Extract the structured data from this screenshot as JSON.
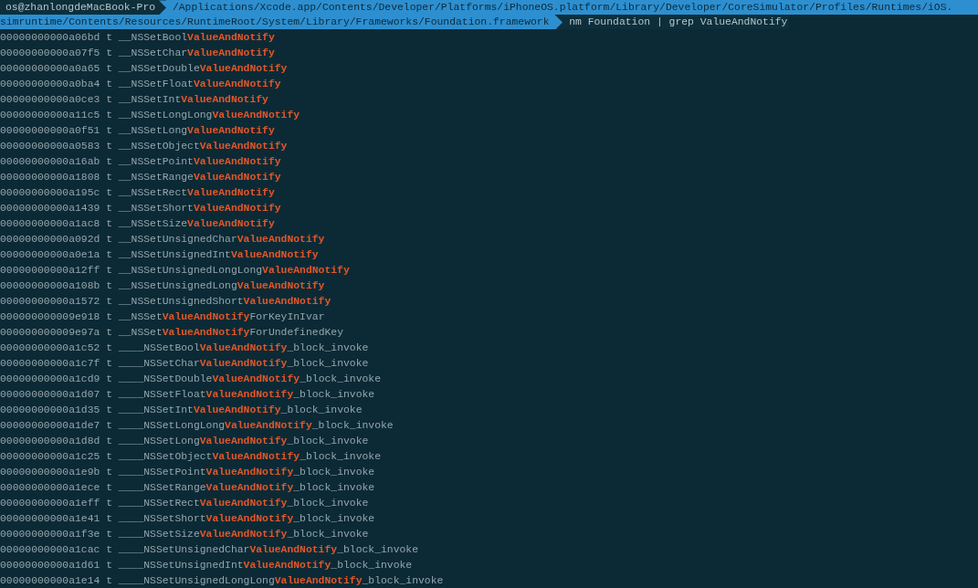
{
  "prompt": {
    "user_host": "os@zhanlongdeMacBook-Pro",
    "path_lines": [
      "/Applications/Xcode.app/Contents/Developer/Platforms/iPhoneOS.platform/Library/Developer/CoreSimulator/Profiles/Runtimes/iOS.",
      "simruntime/Contents/Resources/RuntimeRoot/System/Library/Frameworks/Foundation.framework"
    ],
    "command": "nm Foundation | grep ValueAndNotify"
  },
  "output_lines": [
    "00000000000a06bd t __NSSetBool**ValueAndNotify**",
    "00000000000a07f5 t __NSSetChar**ValueAndNotify**",
    "00000000000a0a65 t __NSSetDouble**ValueAndNotify**",
    "00000000000a0ba4 t __NSSetFloat**ValueAndNotify**",
    "00000000000a0ce3 t __NSSetInt**ValueAndNotify**",
    "00000000000a11c5 t __NSSetLongLong**ValueAndNotify**",
    "00000000000a0f51 t __NSSetLong**ValueAndNotify**",
    "00000000000a0583 t __NSSetObject**ValueAndNotify**",
    "00000000000a16ab t __NSSetPoint**ValueAndNotify**",
    "00000000000a1808 t __NSSetRange**ValueAndNotify**",
    "00000000000a195c t __NSSetRect**ValueAndNotify**",
    "00000000000a1439 t __NSSetShort**ValueAndNotify**",
    "00000000000a1ac8 t __NSSetSize**ValueAndNotify**",
    "00000000000a092d t __NSSetUnsignedChar**ValueAndNotify**",
    "00000000000a0e1a t __NSSetUnsignedInt**ValueAndNotify**",
    "00000000000a12ff t __NSSetUnsignedLongLong**ValueAndNotify**",
    "00000000000a108b t __NSSetUnsignedLong**ValueAndNotify**",
    "00000000000a1572 t __NSSetUnsignedShort**ValueAndNotify**",
    "000000000009e918 t __NSSet**ValueAndNotify**ForKeyInIvar",
    "000000000009e97a t __NSSet**ValueAndNotify**ForUndefinedKey",
    "00000000000a1c52 t ____NSSetBool**ValueAndNotify**_block_invoke",
    "00000000000a1c7f t ____NSSetChar**ValueAndNotify**_block_invoke",
    "00000000000a1cd9 t ____NSSetDouble**ValueAndNotify**_block_invoke",
    "00000000000a1d07 t ____NSSetFloat**ValueAndNotify**_block_invoke",
    "00000000000a1d35 t ____NSSetInt**ValueAndNotify**_block_invoke",
    "00000000000a1de7 t ____NSSetLongLong**ValueAndNotify**_block_invoke",
    "00000000000a1d8d t ____NSSetLong**ValueAndNotify**_block_invoke",
    "00000000000a1c25 t ____NSSetObject**ValueAndNotify**_block_invoke",
    "00000000000a1e9b t ____NSSetPoint**ValueAndNotify**_block_invoke",
    "00000000000a1ece t ____NSSetRange**ValueAndNotify**_block_invoke",
    "00000000000a1eff t ____NSSetRect**ValueAndNotify**_block_invoke",
    "00000000000a1e41 t ____NSSetShort**ValueAndNotify**_block_invoke",
    "00000000000a1f3e t ____NSSetSize**ValueAndNotify**_block_invoke",
    "00000000000a1cac t ____NSSetUnsignedChar**ValueAndNotify**_block_invoke",
    "00000000000a1d61 t ____NSSetUnsignedInt**ValueAndNotify**_block_invoke",
    "00000000000a1e14 t ____NSSetUnsignedLongLong**ValueAndNotify**_block_invoke"
  ]
}
